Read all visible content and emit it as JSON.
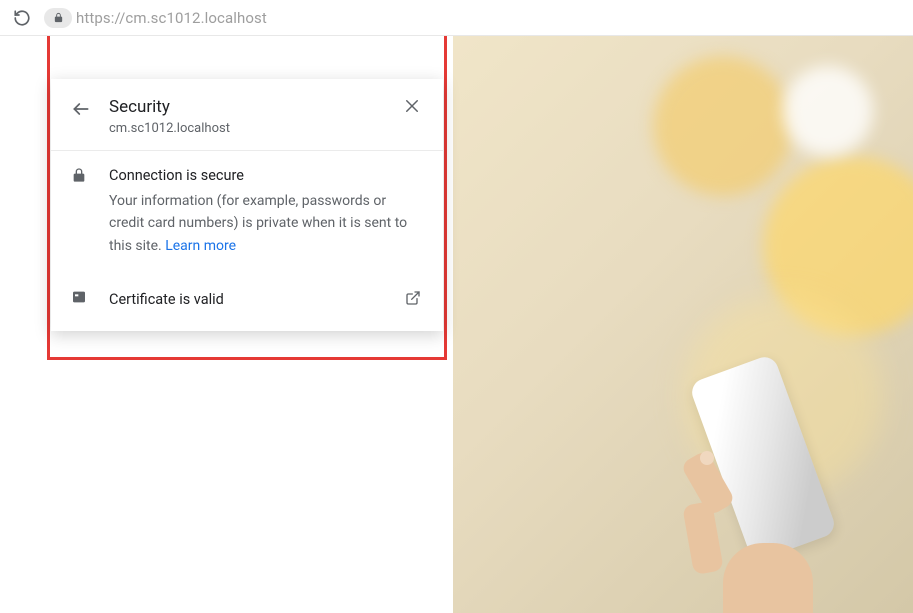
{
  "address_bar": {
    "url": "https://cm.sc1012.localhost"
  },
  "popup": {
    "header": {
      "title": "Security",
      "host": "cm.sc1012.localhost"
    },
    "connection": {
      "label": "Connection is secure",
      "description": "Your information (for example, passwords or credit card numbers) is private when it is sent to this site. ",
      "learn_more": "Learn more"
    },
    "certificate": {
      "label": "Certificate is valid"
    }
  }
}
